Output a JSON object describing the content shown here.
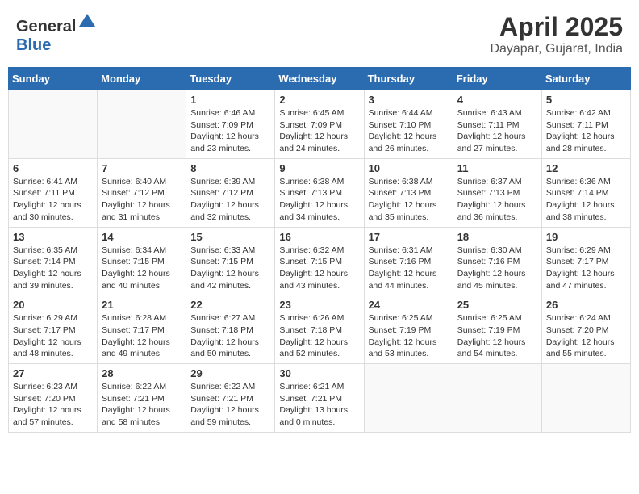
{
  "header": {
    "logo_general": "General",
    "logo_blue": "Blue",
    "month_title": "April 2025",
    "location": "Dayapar, Gujarat, India"
  },
  "days_of_week": [
    "Sunday",
    "Monday",
    "Tuesday",
    "Wednesday",
    "Thursday",
    "Friday",
    "Saturday"
  ],
  "weeks": [
    [
      {
        "day": "",
        "info": ""
      },
      {
        "day": "",
        "info": ""
      },
      {
        "day": "1",
        "info": "Sunrise: 6:46 AM\nSunset: 7:09 PM\nDaylight: 12 hours and 23 minutes."
      },
      {
        "day": "2",
        "info": "Sunrise: 6:45 AM\nSunset: 7:09 PM\nDaylight: 12 hours and 24 minutes."
      },
      {
        "day": "3",
        "info": "Sunrise: 6:44 AM\nSunset: 7:10 PM\nDaylight: 12 hours and 26 minutes."
      },
      {
        "day": "4",
        "info": "Sunrise: 6:43 AM\nSunset: 7:11 PM\nDaylight: 12 hours and 27 minutes."
      },
      {
        "day": "5",
        "info": "Sunrise: 6:42 AM\nSunset: 7:11 PM\nDaylight: 12 hours and 28 minutes."
      }
    ],
    [
      {
        "day": "6",
        "info": "Sunrise: 6:41 AM\nSunset: 7:11 PM\nDaylight: 12 hours and 30 minutes."
      },
      {
        "day": "7",
        "info": "Sunrise: 6:40 AM\nSunset: 7:12 PM\nDaylight: 12 hours and 31 minutes."
      },
      {
        "day": "8",
        "info": "Sunrise: 6:39 AM\nSunset: 7:12 PM\nDaylight: 12 hours and 32 minutes."
      },
      {
        "day": "9",
        "info": "Sunrise: 6:38 AM\nSunset: 7:13 PM\nDaylight: 12 hours and 34 minutes."
      },
      {
        "day": "10",
        "info": "Sunrise: 6:38 AM\nSunset: 7:13 PM\nDaylight: 12 hours and 35 minutes."
      },
      {
        "day": "11",
        "info": "Sunrise: 6:37 AM\nSunset: 7:13 PM\nDaylight: 12 hours and 36 minutes."
      },
      {
        "day": "12",
        "info": "Sunrise: 6:36 AM\nSunset: 7:14 PM\nDaylight: 12 hours and 38 minutes."
      }
    ],
    [
      {
        "day": "13",
        "info": "Sunrise: 6:35 AM\nSunset: 7:14 PM\nDaylight: 12 hours and 39 minutes."
      },
      {
        "day": "14",
        "info": "Sunrise: 6:34 AM\nSunset: 7:15 PM\nDaylight: 12 hours and 40 minutes."
      },
      {
        "day": "15",
        "info": "Sunrise: 6:33 AM\nSunset: 7:15 PM\nDaylight: 12 hours and 42 minutes."
      },
      {
        "day": "16",
        "info": "Sunrise: 6:32 AM\nSunset: 7:15 PM\nDaylight: 12 hours and 43 minutes."
      },
      {
        "day": "17",
        "info": "Sunrise: 6:31 AM\nSunset: 7:16 PM\nDaylight: 12 hours and 44 minutes."
      },
      {
        "day": "18",
        "info": "Sunrise: 6:30 AM\nSunset: 7:16 PM\nDaylight: 12 hours and 45 minutes."
      },
      {
        "day": "19",
        "info": "Sunrise: 6:29 AM\nSunset: 7:17 PM\nDaylight: 12 hours and 47 minutes."
      }
    ],
    [
      {
        "day": "20",
        "info": "Sunrise: 6:29 AM\nSunset: 7:17 PM\nDaylight: 12 hours and 48 minutes."
      },
      {
        "day": "21",
        "info": "Sunrise: 6:28 AM\nSunset: 7:17 PM\nDaylight: 12 hours and 49 minutes."
      },
      {
        "day": "22",
        "info": "Sunrise: 6:27 AM\nSunset: 7:18 PM\nDaylight: 12 hours and 50 minutes."
      },
      {
        "day": "23",
        "info": "Sunrise: 6:26 AM\nSunset: 7:18 PM\nDaylight: 12 hours and 52 minutes."
      },
      {
        "day": "24",
        "info": "Sunrise: 6:25 AM\nSunset: 7:19 PM\nDaylight: 12 hours and 53 minutes."
      },
      {
        "day": "25",
        "info": "Sunrise: 6:25 AM\nSunset: 7:19 PM\nDaylight: 12 hours and 54 minutes."
      },
      {
        "day": "26",
        "info": "Sunrise: 6:24 AM\nSunset: 7:20 PM\nDaylight: 12 hours and 55 minutes."
      }
    ],
    [
      {
        "day": "27",
        "info": "Sunrise: 6:23 AM\nSunset: 7:20 PM\nDaylight: 12 hours and 57 minutes."
      },
      {
        "day": "28",
        "info": "Sunrise: 6:22 AM\nSunset: 7:21 PM\nDaylight: 12 hours and 58 minutes."
      },
      {
        "day": "29",
        "info": "Sunrise: 6:22 AM\nSunset: 7:21 PM\nDaylight: 12 hours and 59 minutes."
      },
      {
        "day": "30",
        "info": "Sunrise: 6:21 AM\nSunset: 7:21 PM\nDaylight: 13 hours and 0 minutes."
      },
      {
        "day": "",
        "info": ""
      },
      {
        "day": "",
        "info": ""
      },
      {
        "day": "",
        "info": ""
      }
    ]
  ]
}
